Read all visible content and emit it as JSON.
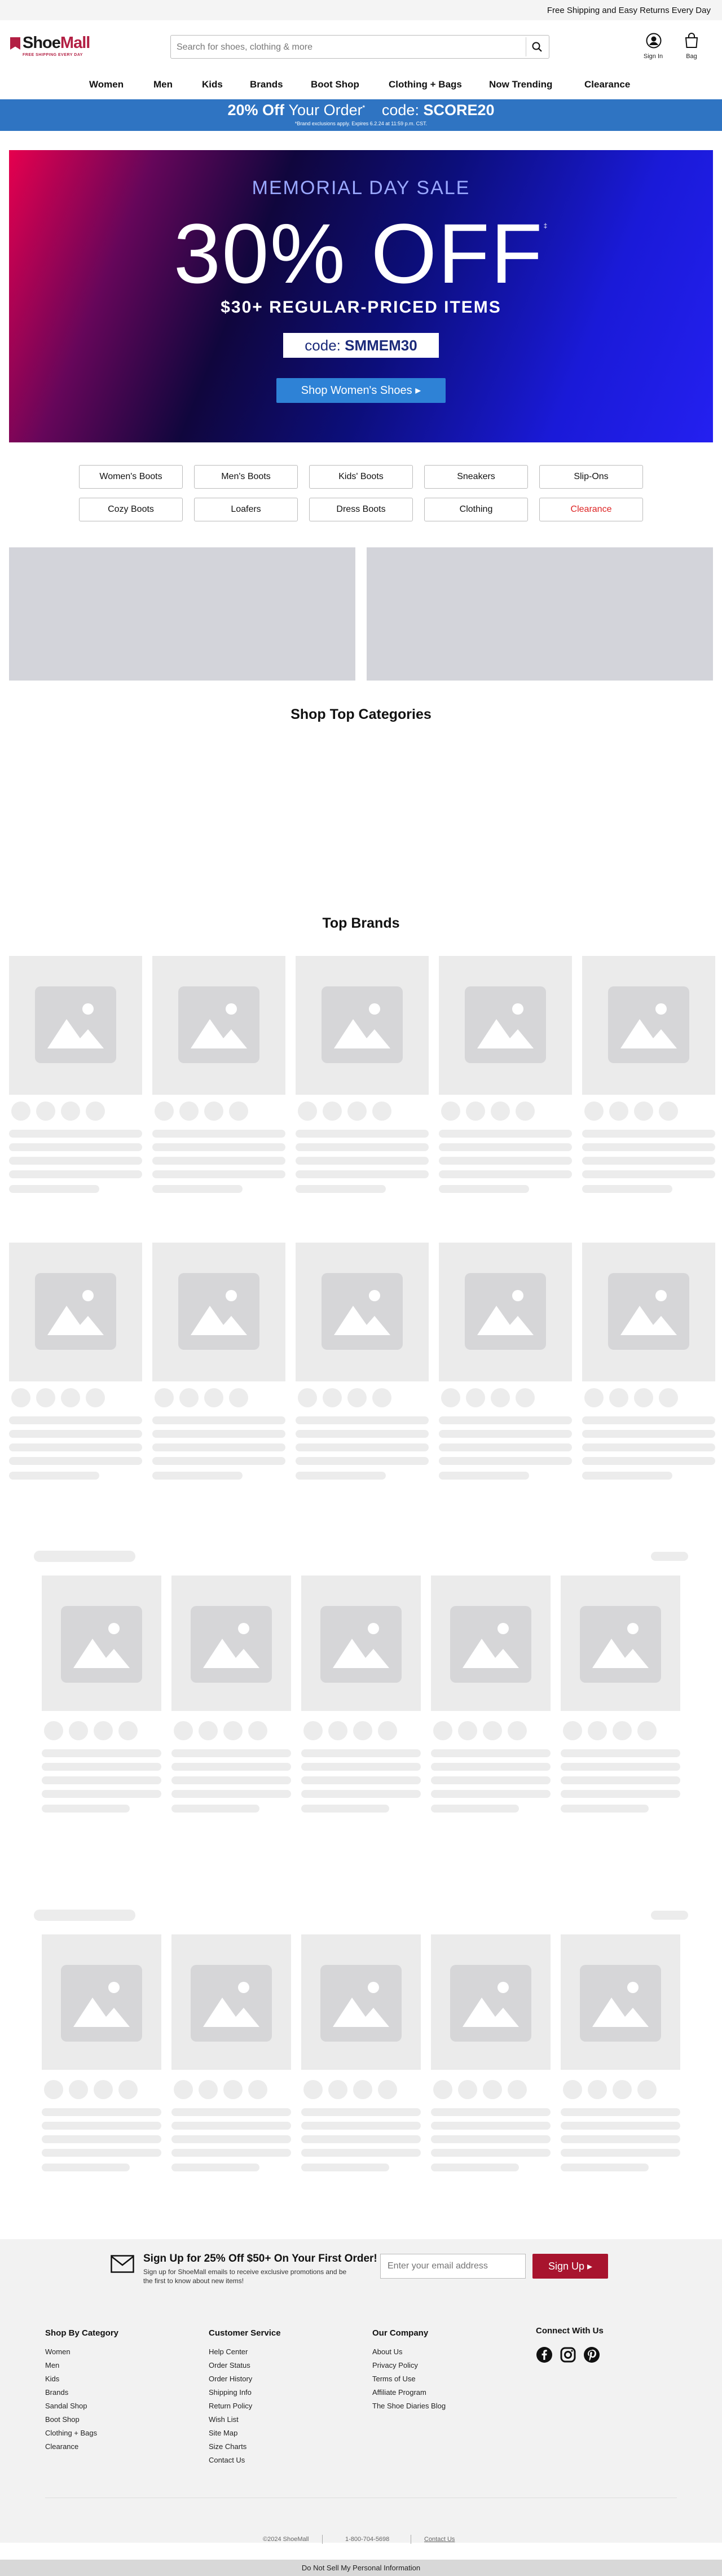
{
  "topbar": {
    "text": "Free Shipping and Easy Returns Every Day"
  },
  "header": {
    "logo_text_a": "Shoe",
    "logo_text_b": "Mall",
    "logo_tagline": "FREE SHIPPING EVERY DAY",
    "search_placeholder": "Search for shoes, clothing & more",
    "sign_in": "Sign In",
    "bag": "Bag"
  },
  "nav": {
    "items": [
      "Women",
      "Men",
      "Kids",
      "Brands",
      "Boot Shop",
      "Clothing + Bags",
      "Now Trending",
      "Clearance"
    ]
  },
  "promo": {
    "headline_bold": "20% Off",
    "headline_light": "Your Order",
    "sup": "*",
    "code_label": "code:",
    "code": "SCORE20",
    "fine_print": "*Brand exclusions apply. Expires 6.2.24 at 11:59 p.m. CST."
  },
  "hero": {
    "eyebrow": "MEMORIAL DAY SALE",
    "big": "30% OFF",
    "sup": "‡",
    "sub": "$30+ REGULAR-PRICED ITEMS",
    "code_label": "code:",
    "code": "SMMEM30",
    "cta": "Shop Women's Shoes ▸",
    "accent_colors": [
      "#e6004e",
      "#10063d",
      "#2420f0"
    ]
  },
  "categories": {
    "row1": [
      "Women's Boots",
      "Men's Boots",
      "Kids' Boots",
      "Sneakers",
      "Slip-Ons"
    ],
    "row2": [
      "Cozy Boots",
      "Loafers",
      "Dress Boots",
      "Clothing",
      "Clearance"
    ]
  },
  "sections": {
    "top_categories": "Shop Top Categories",
    "top_brands": "Top Brands"
  },
  "footer": {
    "signup_title": "Sign Up for 25% Off $50+ On Your First Order!",
    "signup_text": "Sign up for ShoeMall emails to receive exclusive promotions and be the first to know about new items!",
    "email_placeholder": "Enter your email address",
    "signup_button": "Sign Up ▸",
    "columns": [
      {
        "title": "Shop By Category",
        "links": [
          "Women",
          "Men",
          "Kids",
          "Brands",
          "Sandal Shop",
          "Boot Shop",
          "Clothing + Bags",
          "Clearance"
        ]
      },
      {
        "title": "Customer Service",
        "links": [
          "Help Center",
          "Order Status",
          "Order History",
          "Shipping Info",
          "Return Policy",
          "Wish List",
          "Site Map",
          "Size Charts",
          "Contact Us"
        ]
      },
      {
        "title": "Our Company",
        "links": [
          "About Us",
          "Privacy Policy",
          "Terms of Use",
          "Affiliate Program",
          "The Shoe Diaries Blog"
        ]
      },
      {
        "title": "Connect With Us",
        "links": []
      }
    ],
    "social_icons": [
      "facebook-icon",
      "instagram-icon",
      "pinterest-icon"
    ],
    "copyright": "©2024 ShoeMall",
    "phone": "1-800-704-5698",
    "contact": "Contact Us",
    "dns": "Do Not Sell My Personal Information",
    "brand_color": "#a8142e"
  }
}
